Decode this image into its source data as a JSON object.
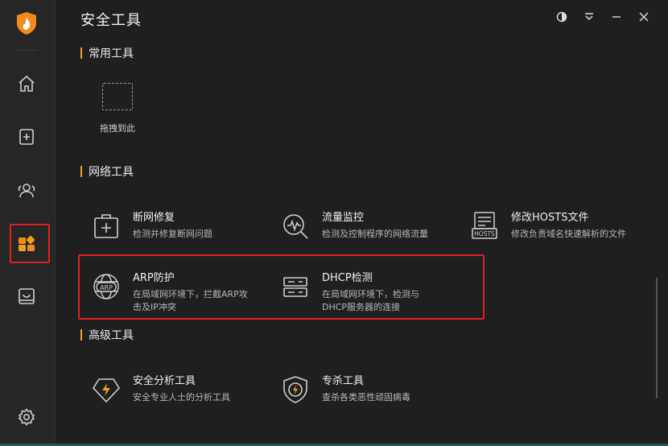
{
  "app": {
    "title": "安全工具"
  },
  "sidebar": {
    "items": [
      {
        "icon": "home-icon"
      },
      {
        "icon": "shield-plus-icon"
      },
      {
        "icon": "users-icon"
      },
      {
        "icon": "apps-icon",
        "active": true
      },
      {
        "icon": "inbox-icon"
      },
      {
        "icon": "settings-icon"
      }
    ]
  },
  "window_controls": [
    "theme-toggle-icon",
    "menu-dropdown-icon",
    "minimize-icon",
    "close-icon"
  ],
  "sections": {
    "common": {
      "title": "常用工具",
      "drop_label": "拖拽到此"
    },
    "network": {
      "title": "网络工具"
    },
    "advanced": {
      "title": "高级工具"
    }
  },
  "tools": {
    "net_repair": {
      "name": "断网修复",
      "desc": "检测并修复断网问题"
    },
    "traffic": {
      "name": "流量监控",
      "desc": "检测及控制程序的网络流量"
    },
    "hosts": {
      "name": "修改HOSTS文件",
      "desc": "修改负责域名快速解析的文件",
      "icon_text": "HOSTS"
    },
    "arp": {
      "name": "ARP防护",
      "desc": "在局域网环境下，拦截ARP攻击及IP冲突",
      "icon_text": "ARP"
    },
    "dhcp": {
      "name": "DHCP检测",
      "desc": "在局域网环境下，检测与DHCP服务器的连接"
    },
    "analysis": {
      "name": "安全分析工具",
      "desc": "安全专业人士的分析工具"
    },
    "killer": {
      "name": "专杀工具",
      "desc": "查杀各类恶性顽固病毒"
    }
  },
  "colors": {
    "accent": "#f0a020",
    "highlight": "#e02020",
    "background": "#1f1f1f",
    "sidebar": "#262626"
  }
}
